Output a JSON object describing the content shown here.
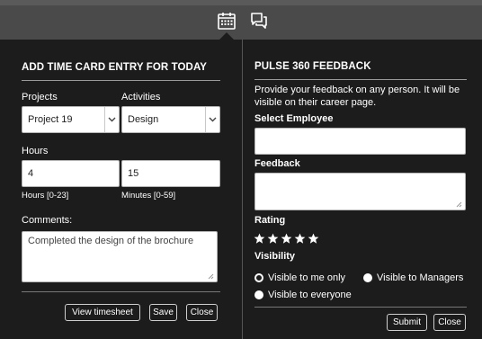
{
  "topbar": {
    "calendar_icon": "calendar-icon",
    "chat_icon": "chat-bubbles-icon"
  },
  "timecard": {
    "title": "ADD TIME CARD ENTRY FOR TODAY",
    "projects_label": "Projects",
    "projects_value": "Project 19",
    "activities_label": "Activities",
    "activities_value": "Design",
    "hours_label": "Hours",
    "hours_value": "4",
    "minutes_value": "15",
    "hours_hint": "Hours [0-23]",
    "minutes_hint": "Minutes [0-59]",
    "comments_label": "Comments:",
    "comments_value": "Completed the design of the brochure",
    "buttons": {
      "view_timesheet": "View timesheet",
      "save": "Save",
      "close": "Close"
    }
  },
  "feedback": {
    "title": "PULSE 360 FEEDBACK",
    "description": "Provide your feedback on any person. It will be visible on their career page.",
    "select_employee_label": "Select Employee",
    "select_employee_value": "",
    "feedback_label": "Feedback",
    "feedback_value": "",
    "rating_label": "Rating",
    "rating_stars": 5,
    "visibility_label": "Visibility",
    "visibility_options": [
      "Visible to me only",
      "Visible to Managers",
      "Visible to everyone"
    ],
    "visibility_selected": "Visible to me only",
    "buttons": {
      "submit": "Submit",
      "close": "Close"
    }
  }
}
